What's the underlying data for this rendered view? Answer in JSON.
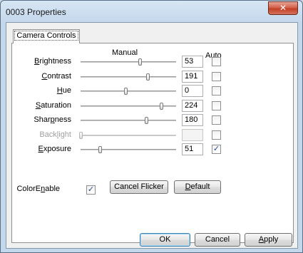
{
  "window": {
    "title": "0003 Properties",
    "close_glyph": "✕"
  },
  "tabs": [
    {
      "label": "Camera Controls"
    }
  ],
  "headers": {
    "manual": "Manual",
    "auto": "Auto"
  },
  "controls": [
    {
      "pre": "",
      "key": "B",
      "post": "rightness",
      "value": "53",
      "slider_fraction": 0.62,
      "auto_checked": false,
      "enabled": true
    },
    {
      "pre": "",
      "key": "C",
      "post": "ontrast",
      "value": "191",
      "slider_fraction": 0.7,
      "auto_checked": false,
      "enabled": true
    },
    {
      "pre": "",
      "key": "H",
      "post": "ue",
      "value": "0",
      "slider_fraction": 0.47,
      "auto_checked": false,
      "enabled": true
    },
    {
      "pre": "",
      "key": "S",
      "post": "aturation",
      "value": "224",
      "slider_fraction": 0.84,
      "auto_checked": false,
      "enabled": true
    },
    {
      "pre": "Shar",
      "key": "p",
      "post": "ness",
      "value": "180",
      "slider_fraction": 0.69,
      "auto_checked": false,
      "enabled": true
    },
    {
      "pre": "Back",
      "key": "l",
      "post": "ight",
      "value": "",
      "slider_fraction": 0.0,
      "auto_checked": false,
      "enabled": false
    },
    {
      "pre": "",
      "key": "E",
      "post": "xposure",
      "value": "51",
      "slider_fraction": 0.2,
      "auto_checked": true,
      "enabled": true
    }
  ],
  "color_enable": {
    "pre": "ColorE",
    "key": "n",
    "post": "able",
    "checked": true
  },
  "buttons": {
    "cancel_flicker": "Cancel Flicker",
    "default_key": "D",
    "default_post": "efault",
    "ok": "OK",
    "cancel": "Cancel",
    "apply_key": "A",
    "apply_post": "pply"
  },
  "check_glyph": "✓"
}
